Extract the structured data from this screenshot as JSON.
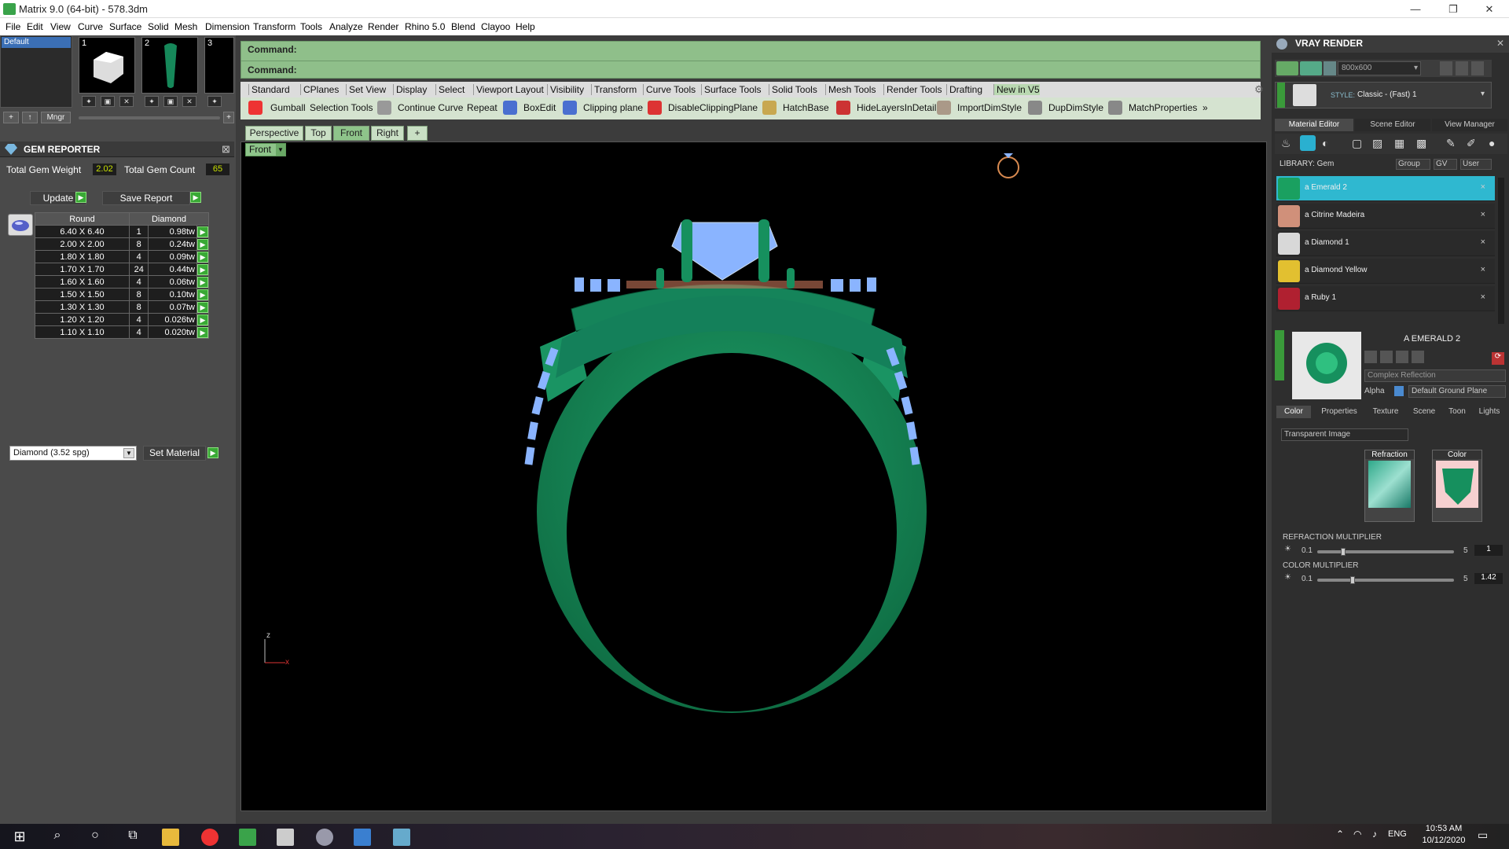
{
  "window": {
    "title": "Matrix 9.0 (64-bit) - 578.3dm"
  },
  "menu": [
    "File",
    "Edit",
    "View",
    "Curve",
    "Surface",
    "Solid",
    "Mesh",
    "Dimension",
    "Transform",
    "Tools",
    "Analyze",
    "Render",
    "Rhino 5.0",
    "Blend",
    "Clayoo",
    "Help"
  ],
  "layers": {
    "selected": "Default",
    "mgr_label": "Mngr",
    "thumbs": [
      "1",
      "2",
      "3"
    ]
  },
  "gem_reporter": {
    "title": "GEM REPORTER",
    "total_weight_label": "Total Gem Weight",
    "total_weight": "2.02",
    "total_count_label": "Total Gem Count",
    "total_count": "65",
    "update_label": "Update",
    "save_label": "Save Report",
    "col_shape": "Round",
    "col_material": "Diamond",
    "rows": [
      {
        "size": "6.40 X 6.40",
        "qty": "1",
        "wt": "0.98tw"
      },
      {
        "size": "2.00 X 2.00",
        "qty": "8",
        "wt": "0.24tw"
      },
      {
        "size": "1.80 X 1.80",
        "qty": "4",
        "wt": "0.09tw"
      },
      {
        "size": "1.70 X 1.70",
        "qty": "24",
        "wt": "0.44tw"
      },
      {
        "size": "1.60 X 1.60",
        "qty": "4",
        "wt": "0.06tw"
      },
      {
        "size": "1.50 X 1.50",
        "qty": "8",
        "wt": "0.10tw"
      },
      {
        "size": "1.30 X 1.30",
        "qty": "8",
        "wt": "0.07tw"
      },
      {
        "size": "1.20 X 1.20",
        "qty": "4",
        "wt": "0.026tw"
      },
      {
        "size": "1.10 X 1.10",
        "qty": "4",
        "wt": "0.020tw"
      }
    ],
    "material_select": "Diamond    (3.52 spg)",
    "set_material_label": "Set Material"
  },
  "command": {
    "line1": "Command:",
    "line2": "Command:"
  },
  "toolbar_tabs": [
    "Standard",
    "CPlanes",
    "Set View",
    "Display",
    "Select",
    "Viewport Layout",
    "Visibility",
    "Transform",
    "Curve Tools",
    "Surface Tools",
    "Solid Tools",
    "Mesh Tools",
    "Render Tools",
    "Drafting",
    "New in V5"
  ],
  "tools": [
    "Gumball",
    "Selection Tools",
    "Continue Curve",
    "Repeat",
    "BoxEdit",
    "Clipping plane",
    "DisableClippingPlane",
    "HatchBase",
    "HideLayersInDetail",
    "ImportDimStyle",
    "DupDimStyle",
    "MatchProperties"
  ],
  "more_tools": "»",
  "viewport_tabs": [
    "Perspective",
    "Top",
    "Front",
    "Right"
  ],
  "viewport_add": "+",
  "active_viewport": "Front",
  "axes": {
    "z": "z",
    "x": "x"
  },
  "vray": {
    "title": "VRAY RENDER",
    "resolution": "800x600",
    "style_label": "STYLE:",
    "style_value": "Classic - (Fast) 1",
    "tabs": [
      "Material Editor",
      "Scene Editor",
      "View Manager"
    ],
    "library_label": "LIBRARY: Gem",
    "lib_buttons": [
      "Group",
      "GV",
      "User"
    ],
    "materials": [
      {
        "name": "a Emerald 2",
        "color": "#1aa060",
        "selected": true
      },
      {
        "name": "a Citrine Madeira",
        "color": "#d0907a",
        "selected": false
      },
      {
        "name": "a Diamond 1",
        "color": "#d8d8d8",
        "selected": false
      },
      {
        "name": "a Diamond Yellow",
        "color": "#e2c030",
        "selected": false
      },
      {
        "name": "a Ruby 1",
        "color": "#b02030",
        "selected": false
      }
    ],
    "remove_symbol": "×",
    "preview_name": "A EMERALD 2",
    "reflection": "Complex Reflection",
    "alpha_label": "Alpha",
    "ground": "Default Ground Plane",
    "subtabs": [
      "Color",
      "Properties",
      "Texture",
      "Scene",
      "Toon",
      "Lights"
    ],
    "transparent": "Transparent Image",
    "refraction_label": "Refraction",
    "color_label": "Color",
    "refraction_mult_label": "REFRACTION MULTIPLIER",
    "refraction_min": "0.1",
    "refraction_max": "5",
    "refraction_value": "1",
    "color_mult_label": "COLOR MULTIPLIER",
    "color_min": "0.1",
    "color_max": "5",
    "color_value": "1.42"
  },
  "taskbar": {
    "time": "10:53 AM",
    "date": "10/12/2020",
    "lang": "ENG"
  },
  "colors": {
    "ring": "#16885a",
    "gem": "#8ab4ff",
    "accent": "#39a935"
  }
}
